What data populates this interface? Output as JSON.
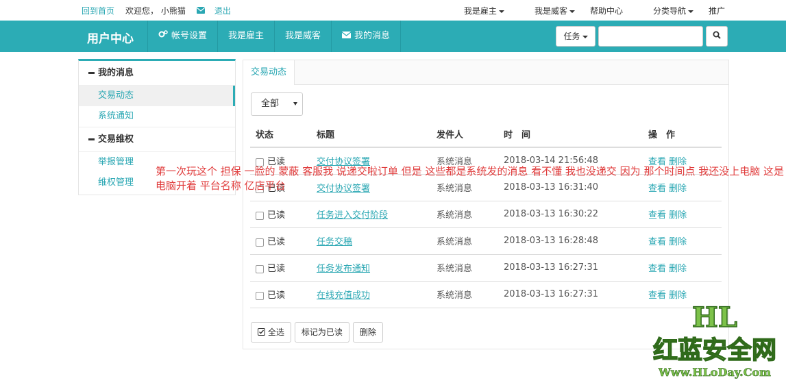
{
  "topbar": {
    "home_link": "回到首页",
    "welcome": "欢迎您， 小熊猫",
    "mail_icon": "envelope-icon",
    "logout": "退出",
    "right_menu": [
      "我是雇主",
      "我是威客",
      "帮助中心",
      "分类导航",
      "推广"
    ]
  },
  "nav": {
    "brand": "用户中心",
    "items": [
      {
        "label": "帐号设置",
        "icon": "cogs-icon"
      },
      {
        "label": "我是雇主"
      },
      {
        "label": "我是威客"
      },
      {
        "label": "我的消息",
        "icon": "envelope-icon"
      }
    ],
    "search_type": "任务",
    "search_value": "",
    "accent": "#2cacb5"
  },
  "sidebar": {
    "group1": "我的消息",
    "group1_items": [
      "交易动态",
      "系统通知"
    ],
    "group2": "交易维权",
    "group2_items": [
      "举报管理",
      "维权管理"
    ]
  },
  "main": {
    "tab": "交易动态",
    "filter": "全部",
    "headers": [
      "状态",
      "标题",
      "发件人",
      "时　间",
      "操　作"
    ],
    "rows": [
      {
        "status": "已读",
        "title": "交付协议签署",
        "sender": "系统消息",
        "time": "2018-03-14 21:56:48",
        "view": "查看",
        "del": "删除"
      },
      {
        "status": "已读",
        "title": "交付协议签署",
        "sender": "系统消息",
        "time": "2018-03-13 16:31:40",
        "view": "查看",
        "del": "删除"
      },
      {
        "status": "已读",
        "title": "任务进入交付阶段",
        "sender": "系统消息",
        "time": "2018-03-13 16:30:22",
        "view": "查看",
        "del": "删除"
      },
      {
        "status": "已读",
        "title": "任务交稿",
        "sender": "系统消息",
        "time": "2018-03-13 16:28:48",
        "view": "查看",
        "del": "删除"
      },
      {
        "status": "已读",
        "title": "任务发布通知",
        "sender": "系统消息",
        "time": "2018-03-13 16:27:31",
        "view": "查看",
        "del": "删除"
      },
      {
        "status": "已读",
        "title": "在线充值成功",
        "sender": "系统消息",
        "time": "2018-03-13 16:27:31",
        "view": "查看",
        "del": "删除"
      }
    ],
    "buttons": {
      "select_all": "全选",
      "mark_read": "标记为已读",
      "delete": "删除"
    }
  },
  "annotation": "第一次玩这个  担保  一脸的 蒙蔽 客服我 说递交啦订单 但是 这些都是系统发的消息   看不懂  我也没递交    因为 那个时间点 我还没上电脑  这是电脑开着  平台名称  亿店平台",
  "watermark": {
    "line1": "HL",
    "line2": "红蓝安全网",
    "line3": "Www.HLoDay.Com"
  }
}
